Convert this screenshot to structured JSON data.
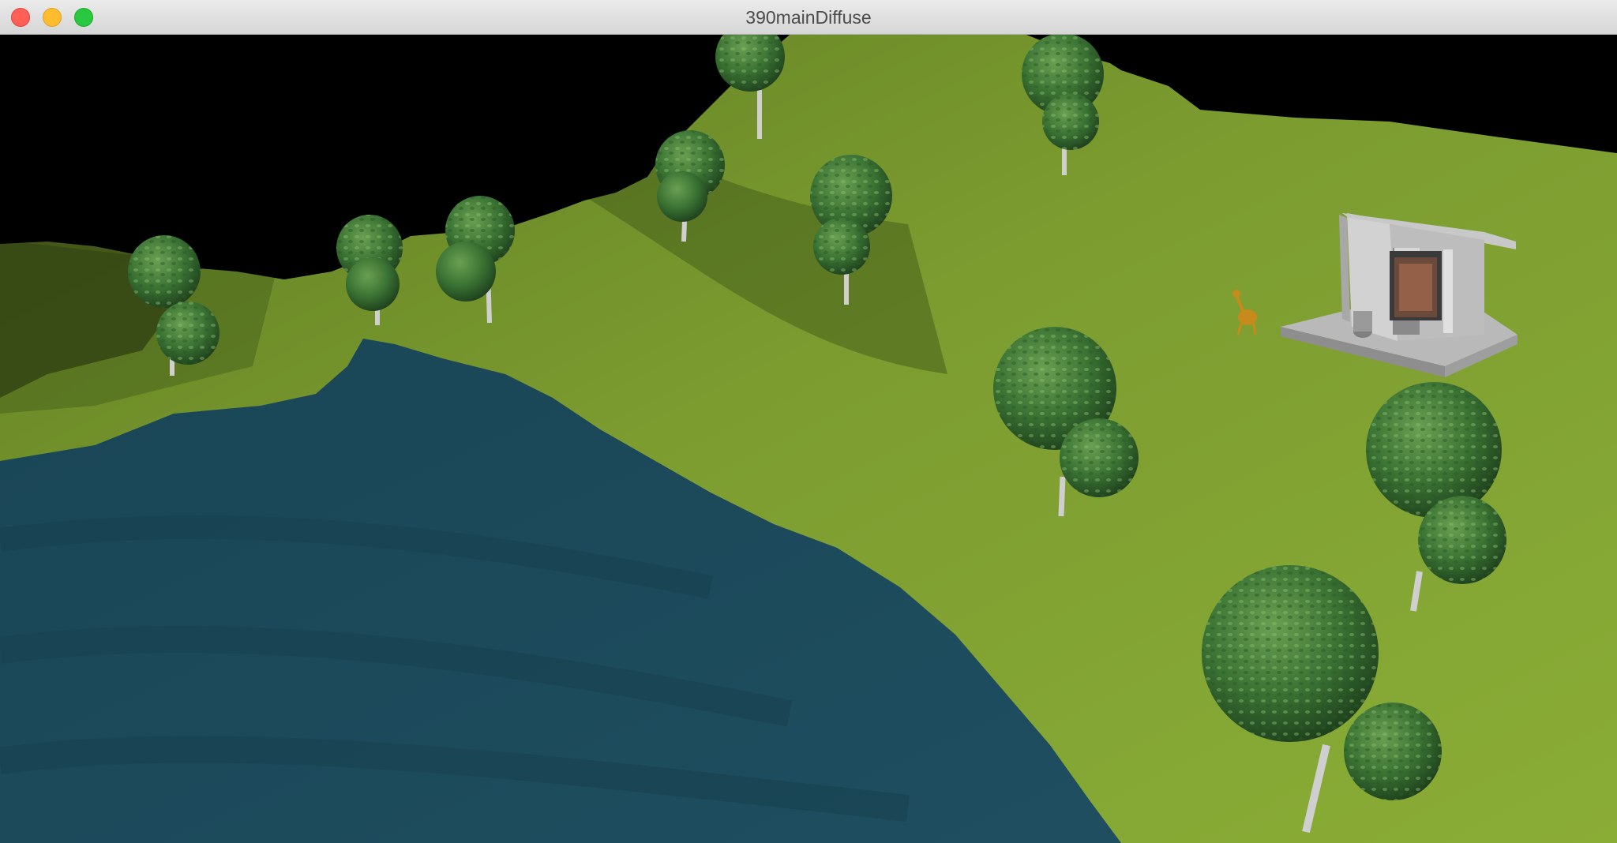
{
  "window": {
    "title": "390mainDiffuse",
    "controls": {
      "close": "close-button",
      "minimize": "minimize-button",
      "zoom": "zoom-button"
    }
  },
  "scene": {
    "colors": {
      "grass": "#7a9a2e",
      "grass_dark": "#4e6a1c",
      "water": "#1c4a5c",
      "foliage": "#3f7a35",
      "trunk": "#d8d8d8",
      "temple": "#c4c4c4",
      "sky": "#000000",
      "figure": "#c88a1a"
    },
    "icons": [
      "tree-icon",
      "temple-icon",
      "creature-icon"
    ]
  }
}
